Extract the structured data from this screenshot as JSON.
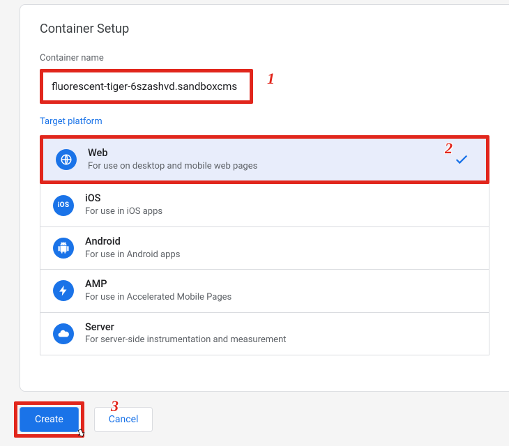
{
  "panel": {
    "title": "Container Setup",
    "name_label": "Container name",
    "name_value": "fluorescent-tiger-6szashvd.sandboxcms",
    "platform_label": "Target platform"
  },
  "platforms": [
    {
      "name": "Web",
      "desc": "For use on desktop and mobile web pages",
      "icon": "globe",
      "selected": true
    },
    {
      "name": "iOS",
      "desc": "For use in iOS apps",
      "icon": "ios",
      "selected": false
    },
    {
      "name": "Android",
      "desc": "For use in Android apps",
      "icon": "android",
      "selected": false
    },
    {
      "name": "AMP",
      "desc": "For use in Accelerated Mobile Pages",
      "icon": "bolt",
      "selected": false
    },
    {
      "name": "Server",
      "desc": "For server-side instrumentation and measurement",
      "icon": "cloud",
      "selected": false
    }
  ],
  "buttons": {
    "create": "Create",
    "cancel": "Cancel"
  },
  "annotations": {
    "a1": "1",
    "a2": "2",
    "a3": "3"
  }
}
